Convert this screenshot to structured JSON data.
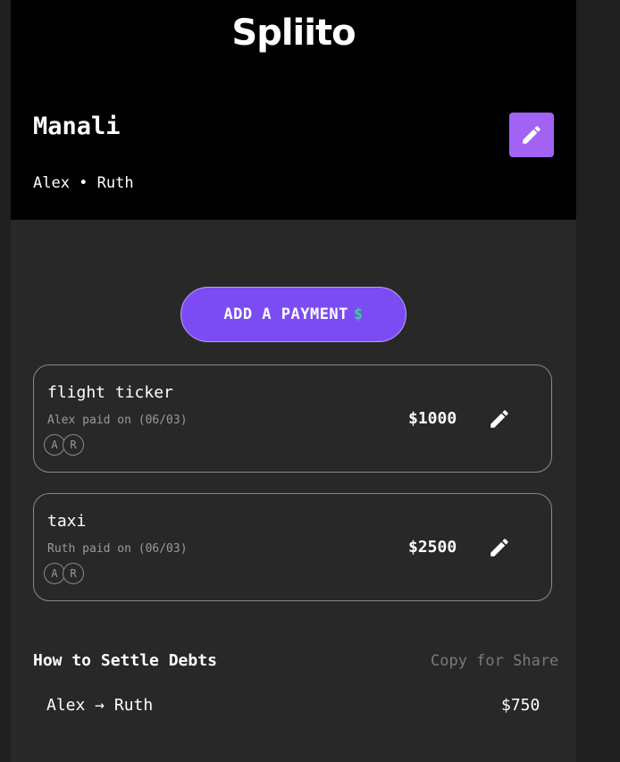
{
  "app": {
    "title": "Spliito"
  },
  "group": {
    "name": "Manali",
    "members": "Alex • Ruth"
  },
  "actions": {
    "add_payment_label": "ADD A PAYMENT",
    "add_payment_icon": "$"
  },
  "payments": [
    {
      "title": "flight ticker",
      "subtitle": "Alex paid on (06/03)",
      "participants": [
        "A",
        "R"
      ],
      "amount": "$1000"
    },
    {
      "title": "taxi",
      "subtitle": "Ruth paid on (06/03)",
      "participants": [
        "A",
        "R"
      ],
      "amount": "$2500"
    }
  ],
  "settle": {
    "title": "How to Settle Debts",
    "copy_label": "Copy for Share",
    "debts": [
      {
        "text": "Alex → Ruth",
        "amount": "$750"
      }
    ]
  },
  "colors": {
    "accent": "#a263f5",
    "button": "#7b4cf4",
    "dollar": "#3fc9a0",
    "header_bg": "#000000",
    "body_bg": "#282828"
  }
}
